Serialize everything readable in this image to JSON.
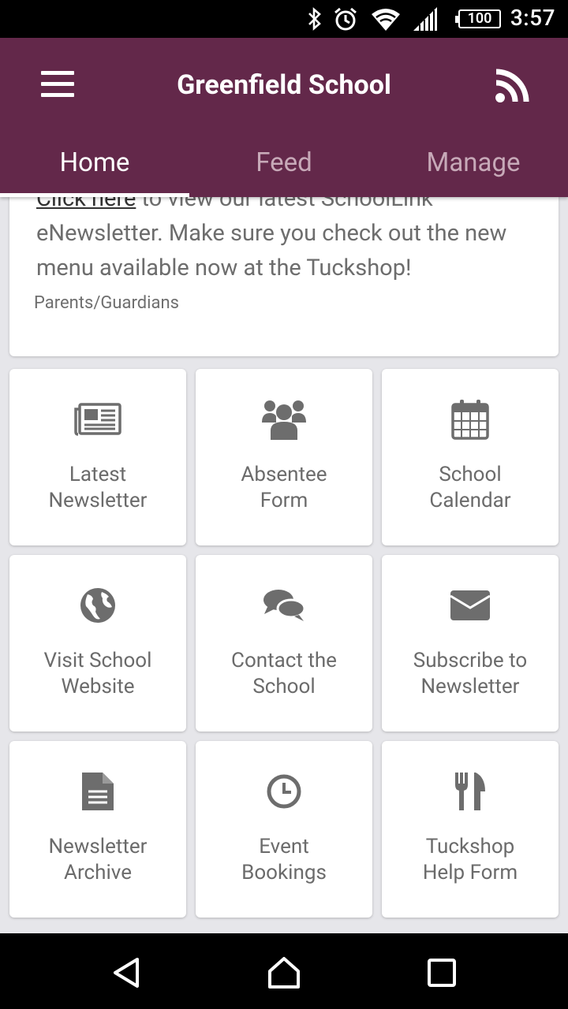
{
  "status_bar": {
    "time": "3:57",
    "battery": "100",
    "icons": [
      "bluetooth-icon",
      "alarm-icon",
      "wifi-icon",
      "cell-signal-icon",
      "battery-icon"
    ]
  },
  "app_bar": {
    "title": "Greenfield School",
    "menu_icon": "hamburger-menu-icon",
    "action_icon": "rss-feed-icon",
    "color": "#63284a"
  },
  "tabs": [
    {
      "label": "Home",
      "active": true
    },
    {
      "label": "Feed",
      "active": false
    },
    {
      "label": "Manage",
      "active": false
    }
  ],
  "news_card": {
    "link_text": "Click here",
    "body_rest": " to view our latest SchoolLink eNewsletter. Make sure you check out the new menu available now at the Tuckshop!",
    "audience": "Parents/Guardians"
  },
  "tiles": [
    {
      "label": "Latest\nNewsletter",
      "icon": "newspaper-icon"
    },
    {
      "label": "Absentee\nForm",
      "icon": "users-group-icon"
    },
    {
      "label": "School\nCalendar",
      "icon": "calendar-icon"
    },
    {
      "label": "Visit School\nWebsite",
      "icon": "globe-icon"
    },
    {
      "label": "Contact the\nSchool",
      "icon": "chat-bubbles-icon"
    },
    {
      "label": "Subscribe to\nNewsletter",
      "icon": "envelope-icon"
    },
    {
      "label": "Newsletter\nArchive",
      "icon": "document-icon"
    },
    {
      "label": "Event\nBookings",
      "icon": "clock-icon"
    },
    {
      "label": "Tuckshop\nHelp Form",
      "icon": "fork-knife-icon"
    }
  ],
  "nav_bar": {
    "icons": [
      "back-icon",
      "home-icon",
      "recents-icon"
    ]
  }
}
